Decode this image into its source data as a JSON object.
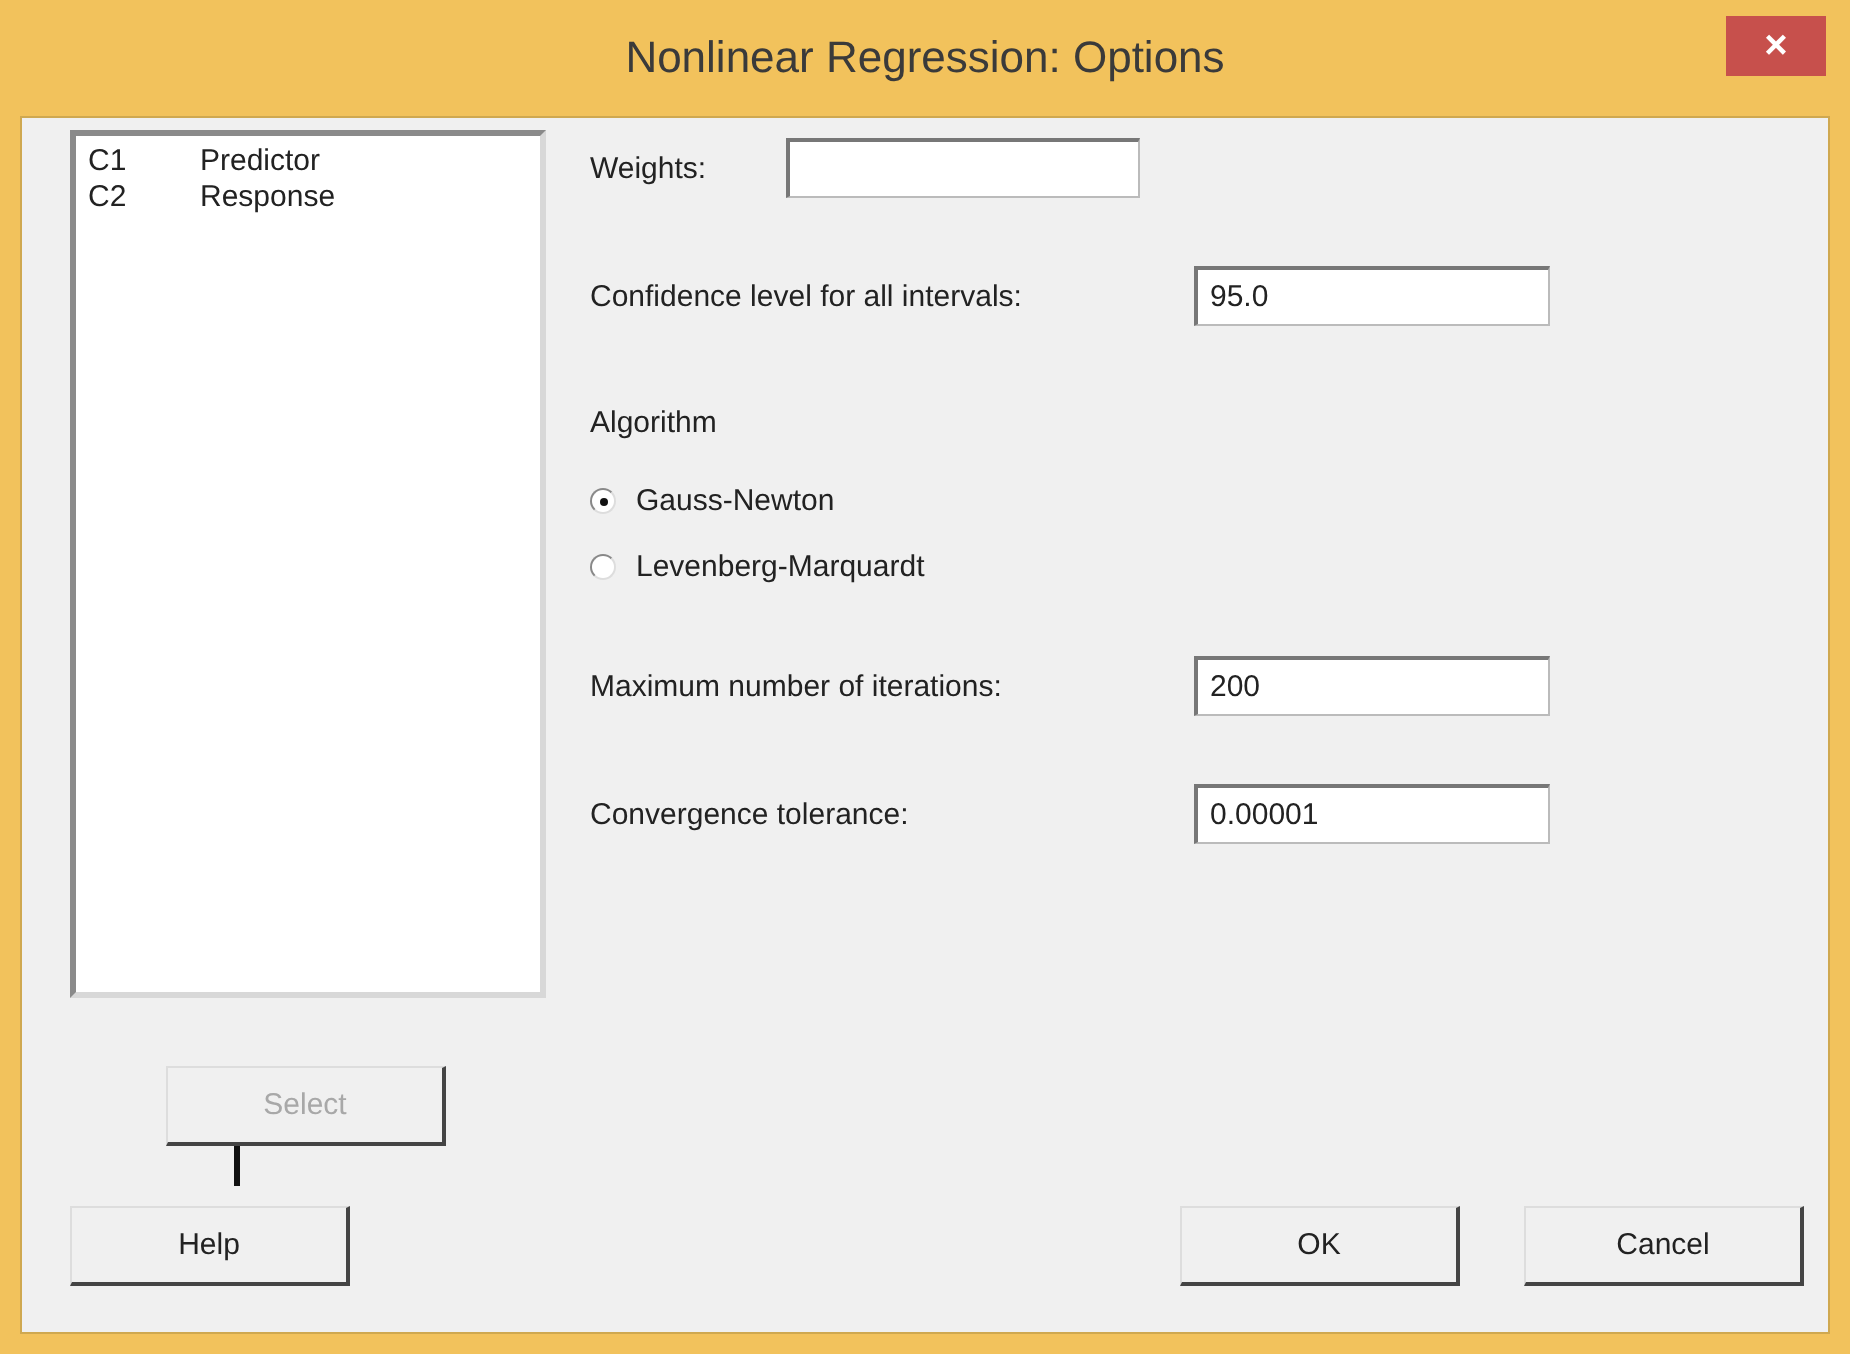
{
  "window": {
    "title": "Nonlinear Regression: Options",
    "close": "×"
  },
  "variables": [
    {
      "column": "C1",
      "name": "Predictor"
    },
    {
      "column": "C2",
      "name": "Response"
    }
  ],
  "select_button": {
    "label": "Select",
    "disabled": true
  },
  "fields": [
    {
      "label": "Weights:"
    },
    {
      "label": "Confidence level for all intervals:",
      "value": "95.0"
    }
  ],
  "algorithm": {
    "label": "Algorithm",
    "options": [
      {
        "label": "Gauss-Newton",
        "selected": true
      },
      {
        "label": "Levenberg-Marquardt",
        "selected": false
      }
    ]
  },
  "more_fields": [
    {
      "label": "Maximum number of iterations:",
      "value": "200"
    },
    {
      "label": "Convergence tolerance:",
      "value": "0.00001"
    }
  ],
  "buttons": {
    "help": "Help",
    "ok": "OK",
    "cancel": "Cancel"
  }
}
